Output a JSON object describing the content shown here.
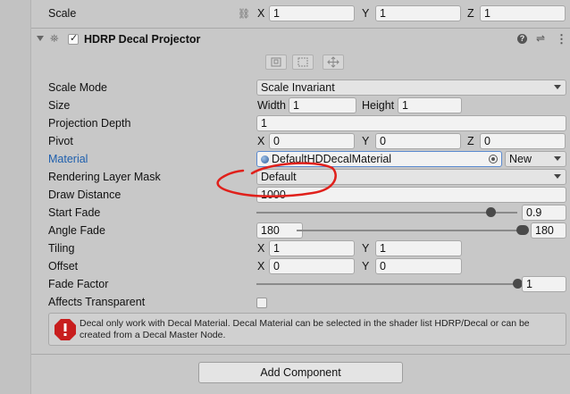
{
  "scale": {
    "label": "Scale",
    "x": "1",
    "y": "1",
    "z": "1"
  },
  "component": {
    "title": "HDRP Decal Projector"
  },
  "axes": {
    "x": "X",
    "y": "Y",
    "z": "Z"
  },
  "fields": {
    "scale_mode": {
      "label": "Scale Mode",
      "value": "Scale Invariant"
    },
    "size": {
      "label": "Size",
      "width_label": "Width",
      "width": "1",
      "height_label": "Height",
      "height": "1"
    },
    "projection_depth": {
      "label": "Projection Depth",
      "value": "1"
    },
    "pivot": {
      "label": "Pivot",
      "x": "0",
      "y": "0",
      "z": "0"
    },
    "material": {
      "label": "Material",
      "value": "DefaultHDDecalMaterial",
      "new_label": "New"
    },
    "rendering_layer_mask": {
      "label": "Rendering Layer Mask",
      "value": "Default"
    },
    "draw_distance": {
      "label": "Draw Distance",
      "value": "1000"
    },
    "start_fade": {
      "label": "Start Fade",
      "value": "0.9",
      "fraction": 0.9
    },
    "angle_fade": {
      "label": "Angle Fade",
      "min": "180",
      "max": "180"
    },
    "tiling": {
      "label": "Tiling",
      "x": "1",
      "y": "1"
    },
    "offset": {
      "label": "Offset",
      "x": "0",
      "y": "0"
    },
    "fade_factor": {
      "label": "Fade Factor",
      "value": "1",
      "fraction": 1.0
    },
    "affects_transparent": {
      "label": "Affects Transparent",
      "checked": false
    }
  },
  "help_box": {
    "text": "Decal only work with Decal Material. Decal Material can be selected in the shader list HDRP/Decal or can be created from a Decal Master Node."
  },
  "add_component": {
    "label": "Add Component"
  },
  "colors": {
    "link": "#1e5fad",
    "annotation": "#e0201b",
    "error": "#c81e1e"
  }
}
